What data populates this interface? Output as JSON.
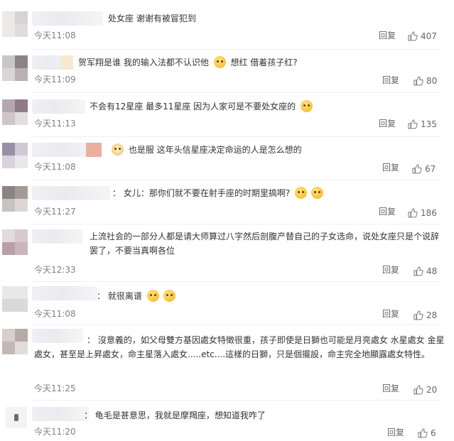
{
  "comments": [
    {
      "text": "处女座 谢谢有被冒犯到",
      "time": "今天11:08",
      "reply": "回复",
      "likes": "407"
    },
    {
      "text_a": "贺军翔是谁 我的输入法都不认识他",
      "text_b": "想红 借着孩子红?",
      "time": "今天11:09",
      "reply": "回复",
      "likes": "80"
    },
    {
      "text": "不会有12星座 最多11星座 因为人家可是不要处女座的",
      "time": "今天11:13",
      "reply": "回复",
      "likes": "135"
    },
    {
      "text": "也是服 这年头信星座决定命运的人是怎么想的",
      "time": "今天11:08",
      "reply": "回复",
      "likes": "67"
    },
    {
      "text": "：  女儿：那你们就不要在射手座的时期里搞啊?",
      "time": "今天11:27",
      "reply": "回复",
      "likes": "186"
    },
    {
      "text": "上流社会的一部分人都是请大师算过八字然后剖腹产替自己的子女选命，说处女座只是个说辞罢了，不要当真啊各位",
      "time": "今天12:33",
      "reply": "回复",
      "likes": "48"
    },
    {
      "text": "：  就很离谱",
      "time": "今天11:08",
      "reply": "回复",
      "likes": "28"
    },
    {
      "text": "：  沒意義的，如父母雙方基因處女特徵很重，孩子即使是日獅也可能是月亮處女 水星處女 金星處女，甚至是上昇處女，命主星落入處女.....etc....這樣的日獅，只是個擺設，命主完全地顯露處女特性。",
      "time": "今天11:25",
      "reply": "回复",
      "likes": "20"
    },
    {
      "text": "：  龟毛是甚意思，我就是摩羯座，想知道我咋了",
      "time": "今天11:20",
      "reply": "回复",
      "likes": "6"
    }
  ],
  "icons": {
    "like": "thumbs-up-icon"
  },
  "colors": {
    "text": "#333333",
    "time": "#808080",
    "action": "#666666",
    "divider": "#f0f0f0"
  }
}
